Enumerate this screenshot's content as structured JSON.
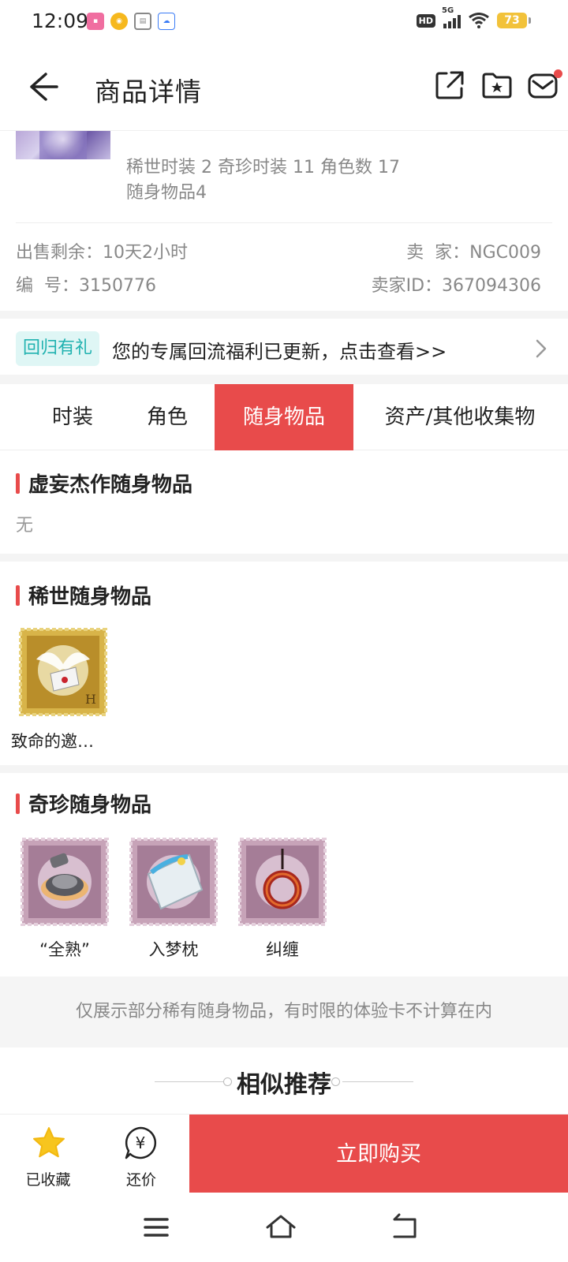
{
  "status_bar": {
    "time": "12:09",
    "battery": "73",
    "network": "5G",
    "hd": "HD",
    "app_icons": [
      "lofter-icon",
      "weibo-icon",
      "clipboard-icon",
      "cloud-icon"
    ]
  },
  "header": {
    "title": "商品详情"
  },
  "summary": {
    "line1": "稀世时装 2 奇珍时装 11 角色数 17",
    "line2": "随身物品4",
    "remaining_label": "出售剩余：10天2小时",
    "seller_label": "卖  家：NGC009",
    "number_label": "编  号：3150776",
    "seller_id_label": "卖家ID：367094306"
  },
  "promo": {
    "tag": "回归有礼",
    "text": "您的专属回流福利已更新，点击查看>>"
  },
  "tabs": [
    {
      "label": "时装",
      "active": false
    },
    {
      "label": "角色",
      "active": false
    },
    {
      "label": "随身物品",
      "active": true
    },
    {
      "label": "资产/其他收集物",
      "active": false
    }
  ],
  "sections": {
    "masterwork": {
      "title": "虚妄杰作随身物品",
      "empty_text": "无"
    },
    "rare": {
      "title": "稀世随身物品",
      "items": [
        {
          "label": "致命的邀…"
        }
      ]
    },
    "precious": {
      "title": "奇珍随身物品",
      "items": [
        {
          "label": "“全熟”"
        },
        {
          "label": "入梦枕"
        },
        {
          "label": "纠缠"
        }
      ]
    }
  },
  "notice": "仅展示部分稀有随身物品，有时限的体验卡不计算在内",
  "recommend": {
    "title": "相似推荐"
  },
  "bottom_bar": {
    "favorited_label": "已收藏",
    "bargain_label": "还价",
    "buy_label": "立即购买"
  },
  "colors": {
    "accent": "#e84b4b",
    "promo_tag_bg": "#dff6f5",
    "promo_tag_text": "#21b2b0",
    "star": "#f7c51e"
  }
}
